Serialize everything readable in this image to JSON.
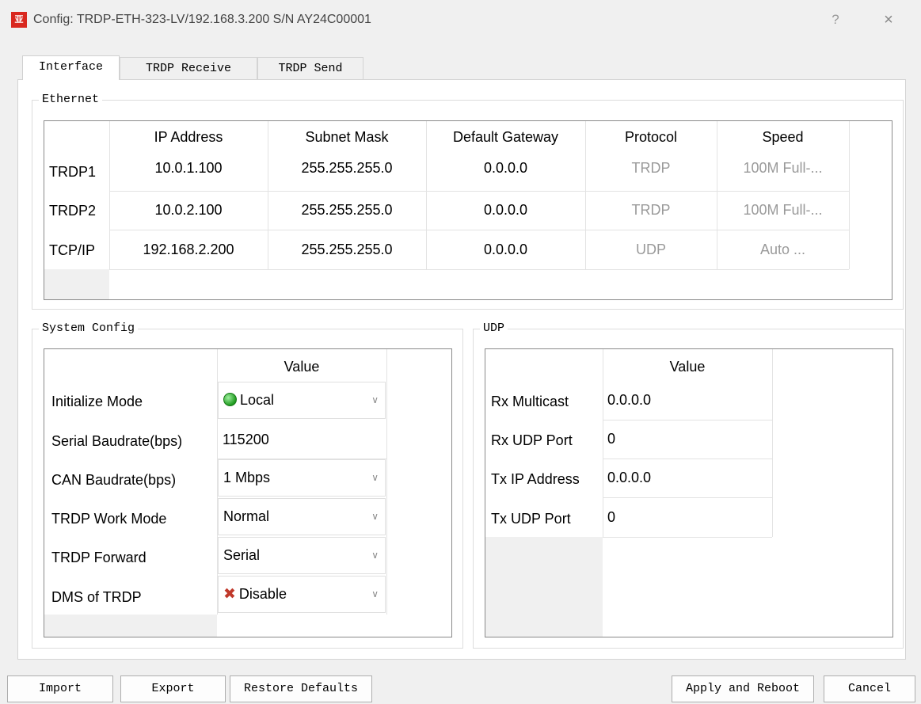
{
  "window": {
    "title": "Config: TRDP-ETH-323-LV/192.168.3.200  S/N AY24C00001",
    "icon_glyph": "亚",
    "help": "?",
    "close": "×"
  },
  "tabs": [
    "Interface",
    "TRDP Receive",
    "TRDP Send"
  ],
  "ethernet": {
    "title": "Ethernet",
    "headers": [
      "IP Address",
      "Subnet Mask",
      "Default Gateway",
      "Protocol",
      "Speed"
    ],
    "rows": [
      {
        "name": "TRDP1",
        "ip": "10.0.1.100",
        "mask": "255.255.255.0",
        "gateway": "0.0.0.0",
        "protocol": "TRDP",
        "speed": "100M Full-..."
      },
      {
        "name": "TRDP2",
        "ip": "10.0.2.100",
        "mask": "255.255.255.0",
        "gateway": "0.0.0.0",
        "protocol": "TRDP",
        "speed": "100M Full-..."
      },
      {
        "name": "TCP/IP",
        "ip": "192.168.2.200",
        "mask": "255.255.255.0",
        "gateway": "0.0.0.0",
        "protocol": "UDP",
        "speed": "Auto ..."
      }
    ]
  },
  "system_config": {
    "title": "System Config",
    "header": "Value",
    "rows": [
      {
        "label": "Initialize Mode",
        "value": "Local",
        "icon": "green-led-icon",
        "combo": true
      },
      {
        "label": "Serial Baudrate(bps)",
        "value": "115200",
        "combo": false
      },
      {
        "label": "CAN Baudrate(bps)",
        "value": "1 Mbps",
        "combo": true
      },
      {
        "label": "TRDP Work Mode",
        "value": "Normal",
        "combo": true
      },
      {
        "label": "TRDP Forward",
        "value": "Serial",
        "combo": true
      },
      {
        "label": "DMS of TRDP",
        "value": "Disable",
        "icon": "red-x-icon",
        "combo": true
      }
    ]
  },
  "udp": {
    "title": "UDP",
    "header": "Value",
    "rows": [
      {
        "label": "Rx Multicast",
        "value": "0.0.0.0"
      },
      {
        "label": "Rx UDP Port",
        "value": "0"
      },
      {
        "label": "Tx IP Address",
        "value": "0.0.0.0"
      },
      {
        "label": "Tx UDP Port",
        "value": "0"
      }
    ]
  },
  "buttons": {
    "import": "Import",
    "export": "Export",
    "restore": "Restore Defaults",
    "apply": "Apply and Reboot",
    "cancel": "Cancel"
  },
  "icons": {
    "dropdown": "chevron-down-icon",
    "led": "green-led-icon",
    "disable": "red-x-icon"
  },
  "colors": {
    "window_bg": "#f0f0f0",
    "grid_border": "#8a8a8a",
    "disabled_text": "#9a9a9a",
    "led_green": "#1e9a1e",
    "x_red": "#c0392b",
    "icon_red": "#d9281f"
  }
}
